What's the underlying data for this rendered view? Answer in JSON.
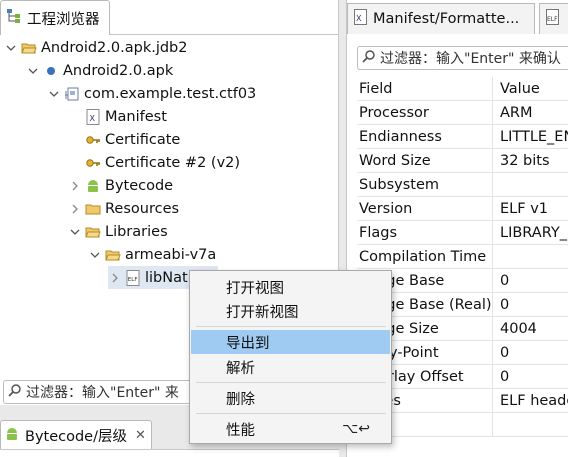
{
  "left": {
    "tab_label": "工程浏览器",
    "filter_placeholder": "过滤器：输入\"Enter\" 来",
    "tree": [
      {
        "label": "Android2.0.apk.jdb2",
        "icon": "folder-open-icon",
        "twisty": "down"
      },
      {
        "label": "Android2.0.apk",
        "icon": "dot-icon",
        "twisty": "down"
      },
      {
        "label": "com.example.test.ctf03",
        "icon": "package-icon",
        "twisty": "down"
      },
      {
        "label": "Manifest",
        "icon": "xml-file-icon",
        "twisty": ""
      },
      {
        "label": "Certificate",
        "icon": "key-icon",
        "twisty": ""
      },
      {
        "label": "Certificate #2 (v2)",
        "icon": "key-icon",
        "twisty": ""
      },
      {
        "label": "Bytecode",
        "icon": "android-icon",
        "twisty": "right"
      },
      {
        "label": "Resources",
        "icon": "folder-icon",
        "twisty": "right"
      },
      {
        "label": "Libraries",
        "icon": "folder-open-icon",
        "twisty": "down"
      },
      {
        "label": "armeabi-v7a",
        "icon": "folder-open-icon",
        "twisty": "down"
      },
      {
        "label": "libNat",
        "icon": "elf-file-icon",
        "twisty": "right"
      }
    ]
  },
  "bottom": {
    "tab_label": "Bytecode/层级",
    "close": "✕"
  },
  "right": {
    "tabs": [
      "Manifest/Formatte...",
      ""
    ],
    "filter_placeholder": "过滤器：输入\"Enter\" 来确认",
    "header": [
      "Field",
      "Value"
    ],
    "rows": [
      [
        "Processor",
        "ARM"
      ],
      [
        "Endianness",
        "LITTLE_EN"
      ],
      [
        "Word Size",
        "32 bits"
      ],
      [
        "Subsystem",
        ""
      ],
      [
        "Version",
        "ELF v1"
      ],
      [
        "Flags",
        "LIBRARY_"
      ],
      [
        "Compilation Time",
        ""
      ],
      [
        "Image Base",
        "0"
      ],
      [
        "Image Base (Real)",
        "0"
      ],
      [
        "Image Size",
        "4004"
      ],
      [
        "Entry-Point",
        "0"
      ],
      [
        "Overlay Offset",
        "0"
      ],
      [
        "Notes",
        "ELF heade"
      ],
      [
        "",
        ""
      ]
    ]
  },
  "menu": {
    "items": [
      {
        "label": "打开视图",
        "shortcut": ""
      },
      {
        "label": "打开新视图",
        "shortcut": ""
      },
      {
        "label": "导出到",
        "shortcut": ""
      },
      {
        "label": "解析",
        "shortcut": ""
      },
      {
        "label": "删除",
        "shortcut": ""
      },
      {
        "label": "性能",
        "shortcut": "⌥↩"
      }
    ],
    "highlighted_index": 2
  },
  "colors": {
    "selection": "#9fcbf3",
    "tree_selected": "#dfe7f3"
  }
}
